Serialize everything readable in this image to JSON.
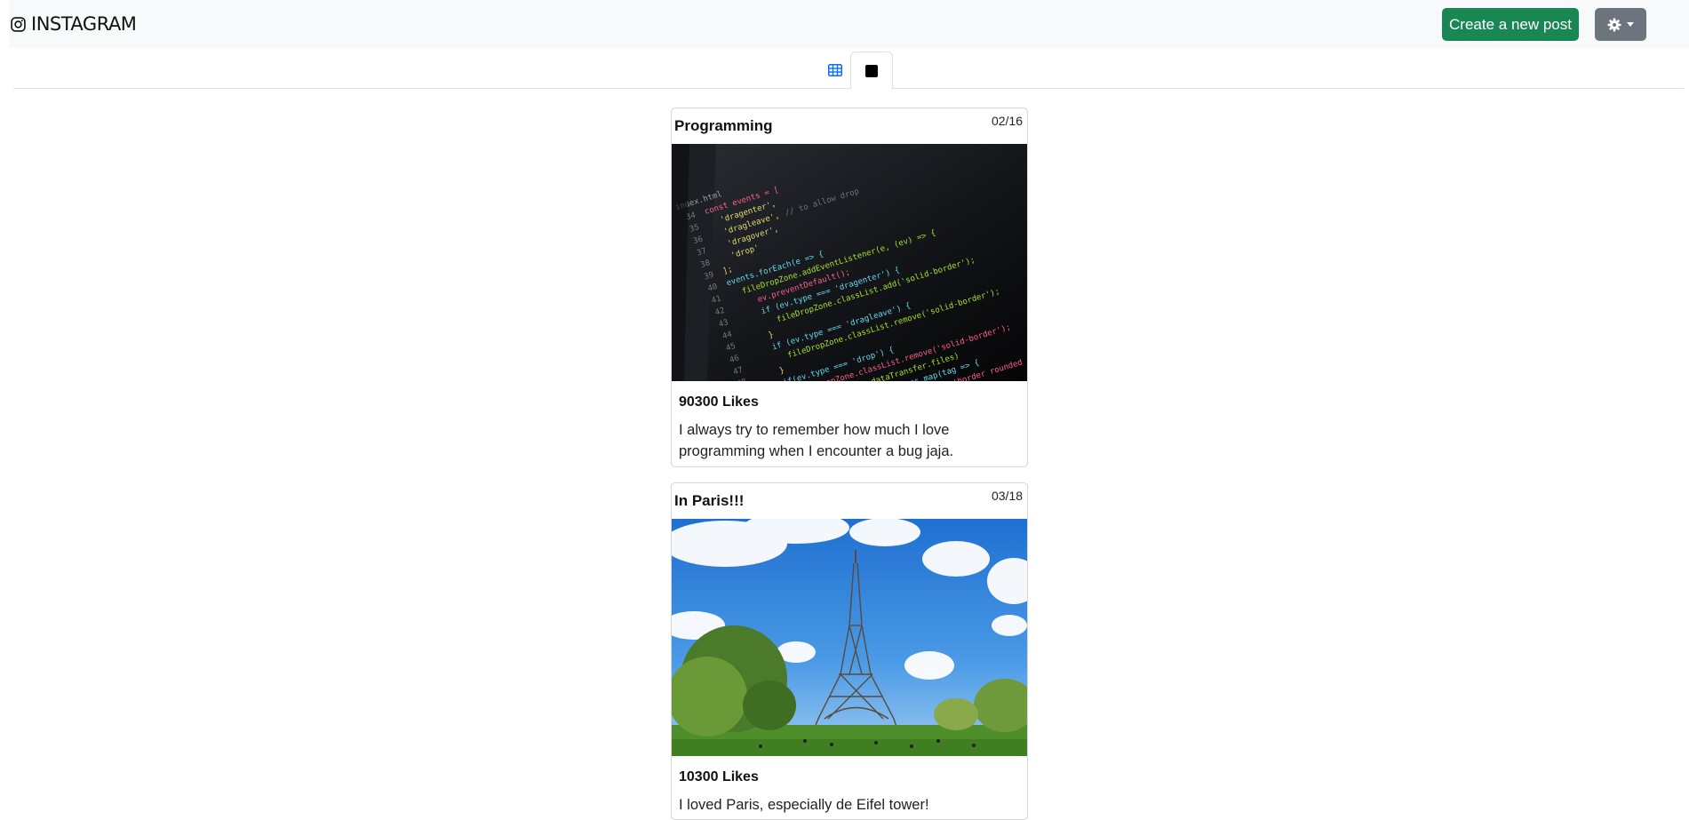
{
  "brand": {
    "name": "INSTAGRAM",
    "icon": "instagram-icon"
  },
  "header": {
    "create_label": "Create a new post",
    "settings_icon": "gear-icon"
  },
  "tabs": [
    {
      "icon": "grid-icon",
      "active": false
    },
    {
      "icon": "square-icon",
      "active": true
    }
  ],
  "posts": [
    {
      "title": "Programming",
      "date": "02/16",
      "likes": "90300 Likes",
      "caption": "I always try to remember how much I love programming when I encounter a bug jaja.",
      "image": "code-editor-photo"
    },
    {
      "title": "In Paris!!!",
      "date": "03/18",
      "likes": "10300 Likes",
      "caption": "I loved Paris, especially de Eifel tower!",
      "image": "eiffel-tower-photo"
    }
  ],
  "colors": {
    "create_button": "#198754",
    "settings_button": "#6c757d",
    "navbar_bg": "#f8f9fa",
    "active_tab_icon": "#0d6efd"
  }
}
